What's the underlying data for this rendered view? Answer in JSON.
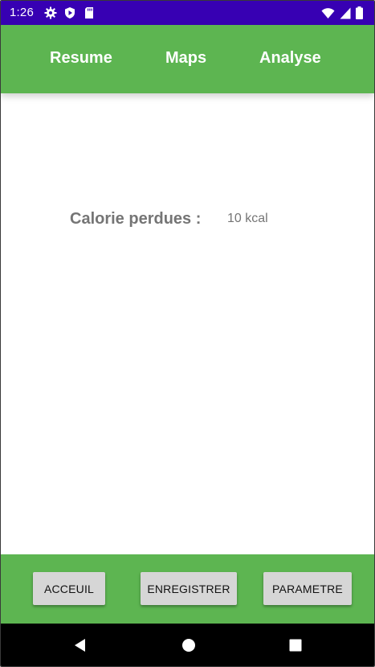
{
  "status_bar": {
    "time": "1:26",
    "icons_left": [
      "gear-icon",
      "play-shield-icon",
      "sd-card-icon"
    ],
    "icons_right": [
      "wifi-icon",
      "signal-icon",
      "battery-icon"
    ],
    "background": "#3700b3"
  },
  "tabs": [
    {
      "label": "Resume"
    },
    {
      "label": "Maps"
    },
    {
      "label": "Analyse"
    }
  ],
  "content": {
    "calorie_label": "Calorie perdues :",
    "calorie_value": "10 kcal"
  },
  "bottom_buttons": {
    "acceuil": "ACCEUIL",
    "enregistrer": "ENREGISTRER",
    "parametre": "PARAMETRE"
  },
  "nav_bar": {
    "icons": [
      "back-icon",
      "home-icon",
      "recents-icon"
    ]
  },
  "colors": {
    "accent_green": "#5db551",
    "status_purple": "#3700b3",
    "label_gray": "#757575",
    "button_gray": "#d6d6d6"
  }
}
